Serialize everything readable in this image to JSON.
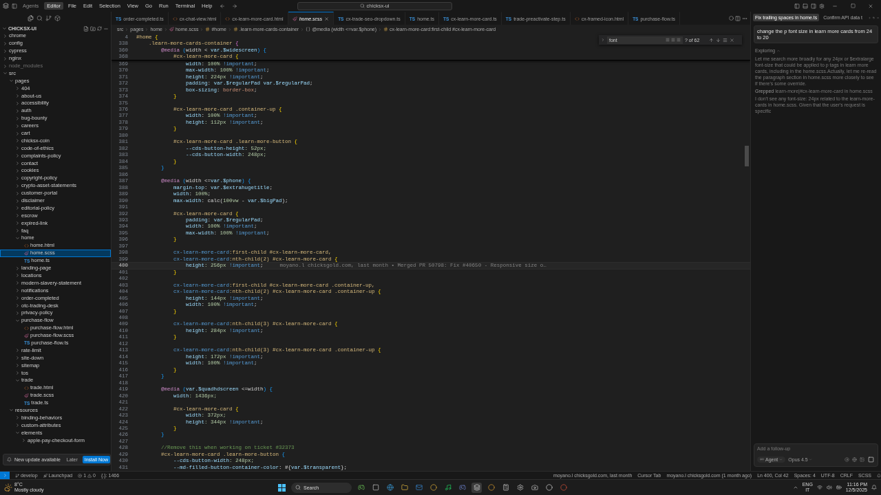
{
  "title_bar": {
    "modes": [
      {
        "label": "Agents",
        "selected": false
      },
      {
        "label": "Editor",
        "selected": true
      }
    ],
    "menu": [
      "File",
      "Edit",
      "Selection",
      "View",
      "Go",
      "Run",
      "Terminal",
      "Help"
    ],
    "search": {
      "value": "chicksx-ui"
    }
  },
  "explorer": {
    "title": "CHICKSX-UI",
    "expanded": true,
    "tree": [
      {
        "label": "chrome",
        "kind": "folder",
        "expanded": false,
        "selected": false,
        "ignored": false
      },
      {
        "label": "config",
        "kind": "folder",
        "expanded": false,
        "selected": false,
        "ignored": false
      },
      {
        "label": "cypress",
        "kind": "folder",
        "expanded": false,
        "selected": false,
        "ignored": false
      },
      {
        "label": "nginx",
        "kind": "folder",
        "expanded": false,
        "selected": false,
        "ignored": false
      },
      {
        "label": "node_modules",
        "kind": "folder",
        "expanded": false,
        "selected": false,
        "ignored": true
      },
      {
        "label": "src",
        "kind": "folder",
        "expanded": true,
        "selected": false,
        "ignored": false,
        "children": [
          {
            "label": "pages",
            "kind": "folder",
            "expanded": true,
            "selected": false,
            "children": [
              {
                "label": "404",
                "kind": "folder",
                "expanded": false,
                "selected": false
              },
              {
                "label": "about-us",
                "kind": "folder",
                "expanded": false,
                "selected": false
              },
              {
                "label": "accessibility",
                "kind": "folder",
                "expanded": false,
                "selected": false
              },
              {
                "label": "auth",
                "kind": "folder",
                "expanded": false,
                "selected": false
              },
              {
                "label": "bug-bounty",
                "kind": "folder",
                "expanded": false,
                "selected": false
              },
              {
                "label": "careers",
                "kind": "folder",
                "expanded": false,
                "selected": false
              },
              {
                "label": "cart",
                "kind": "folder",
                "expanded": false,
                "selected": false
              },
              {
                "label": "chicksx-coin",
                "kind": "folder",
                "expanded": false,
                "selected": false
              },
              {
                "label": "code-of-ethics",
                "kind": "folder",
                "expanded": false,
                "selected": false
              },
              {
                "label": "complaints-policy",
                "kind": "folder",
                "expanded": false,
                "selected": false
              },
              {
                "label": "contact",
                "kind": "folder",
                "expanded": false,
                "selected": false
              },
              {
                "label": "cookies",
                "kind": "folder",
                "expanded": false,
                "selected": false
              },
              {
                "label": "copyright-policy",
                "kind": "folder",
                "expanded": false,
                "selected": false
              },
              {
                "label": "crypto-asset-statements",
                "kind": "folder",
                "expanded": false,
                "selected": false
              },
              {
                "label": "customer-portal",
                "kind": "folder",
                "expanded": false,
                "selected": false
              },
              {
                "label": "disclaimer",
                "kind": "folder",
                "expanded": false,
                "selected": false
              },
              {
                "label": "editorial-policy",
                "kind": "folder",
                "expanded": false,
                "selected": false
              },
              {
                "label": "escrow",
                "kind": "folder",
                "expanded": false,
                "selected": false
              },
              {
                "label": "expired-link",
                "kind": "folder",
                "expanded": false,
                "selected": false
              },
              {
                "label": "faq",
                "kind": "folder",
                "expanded": false,
                "selected": false
              },
              {
                "label": "home",
                "kind": "folder",
                "expanded": true,
                "selected": false,
                "children": [
                  {
                    "label": "home.html",
                    "kind": "html",
                    "selected": false
                  },
                  {
                    "label": "home.scss",
                    "kind": "scss",
                    "selected": true
                  },
                  {
                    "label": "home.ts",
                    "kind": "ts",
                    "badge": "TS",
                    "selected": false
                  }
                ]
              },
              {
                "label": "landing-page",
                "kind": "folder",
                "expanded": false,
                "selected": false
              },
              {
                "label": "locations",
                "kind": "folder",
                "expanded": false,
                "selected": false
              },
              {
                "label": "modern-slavery-statement",
                "kind": "folder",
                "expanded": false,
                "selected": false
              },
              {
                "label": "notifications",
                "kind": "folder",
                "expanded": false,
                "selected": false
              },
              {
                "label": "order-completed",
                "kind": "folder",
                "expanded": false,
                "selected": false
              },
              {
                "label": "otc-trading-desk",
                "kind": "folder",
                "expanded": false,
                "selected": false
              },
              {
                "label": "privacy-policy",
                "kind": "folder",
                "expanded": false,
                "selected": false
              },
              {
                "label": "purchase-flow",
                "kind": "folder",
                "expanded": true,
                "selected": false,
                "children": [
                  {
                    "label": "purchase-flow.html",
                    "kind": "html",
                    "selected": false
                  },
                  {
                    "label": "purchase-flow.scss",
                    "kind": "scss",
                    "selected": false
                  },
                  {
                    "label": "purchase-flow.ts",
                    "kind": "ts",
                    "badge": "TS",
                    "selected": false
                  }
                ]
              },
              {
                "label": "rate-limit",
                "kind": "folder",
                "expanded": false,
                "selected": false
              },
              {
                "label": "site-down",
                "kind": "folder",
                "expanded": false,
                "selected": false
              },
              {
                "label": "sitemap",
                "kind": "folder",
                "expanded": false,
                "selected": false
              },
              {
                "label": "tos",
                "kind": "folder",
                "expanded": false,
                "selected": false
              },
              {
                "label": "trade",
                "kind": "folder",
                "expanded": true,
                "selected": false,
                "children": [
                  {
                    "label": "trade.html",
                    "kind": "html",
                    "selected": false
                  },
                  {
                    "label": "trade.scss",
                    "kind": "scss",
                    "selected": false
                  },
                  {
                    "label": "trade.ts",
                    "kind": "ts",
                    "badge": "TS",
                    "selected": false
                  }
                ]
              }
            ]
          },
          {
            "label": "resources",
            "kind": "folder",
            "expanded": true,
            "selected": false,
            "children": [
              {
                "label": "binding-behaviors",
                "kind": "folder",
                "expanded": false,
                "selected": false
              },
              {
                "label": "custom-attributes",
                "kind": "folder",
                "expanded": false,
                "selected": false
              },
              {
                "label": "elements",
                "kind": "folder",
                "expanded": true,
                "selected": false,
                "children": [
                  {
                    "label": "apple-pay-checkout-form",
                    "kind": "folder",
                    "expanded": false,
                    "selected": false
                  }
                ]
              }
            ]
          }
        ]
      }
    ]
  },
  "notification": {
    "message": "New update available",
    "actions": [
      {
        "label": "Later",
        "primary": false
      },
      {
        "label": "Install Now",
        "primary": true
      }
    ]
  },
  "tabs": [
    {
      "label": "order-completed.ts",
      "kind": "ts",
      "badge": "TS",
      "selected": false
    },
    {
      "label": "cx-chat-view.html",
      "kind": "html",
      "selected": false
    },
    {
      "label": "cx-learn-more-card.html",
      "kind": "html",
      "selected": false
    },
    {
      "label": "home.scss",
      "kind": "scss",
      "selected": true
    },
    {
      "label": "cx-trade-seo-dropdown.ts",
      "kind": "ts",
      "badge": "TS",
      "selected": false
    },
    {
      "label": "home.ts",
      "kind": "ts",
      "badge": "TS",
      "selected": false
    },
    {
      "label": "cx-learn-more-card.ts",
      "kind": "ts",
      "badge": "TS",
      "selected": false
    },
    {
      "label": "trade-preactivate-step.ts",
      "kind": "ts",
      "badge": "TS",
      "selected": false
    },
    {
      "label": "cx-framed-icon.html",
      "kind": "html",
      "selected": false
    },
    {
      "label": "purchase-flow.ts",
      "kind": "ts",
      "badge": "TS",
      "selected": false
    }
  ],
  "breadcrumb": [
    {
      "kind": "text",
      "text": "src"
    },
    {
      "kind": "text",
      "text": "pages"
    },
    {
      "kind": "text",
      "text": "home"
    },
    {
      "kind": "scss",
      "text": "home.scss"
    },
    {
      "kind": "selector",
      "text": "#home"
    },
    {
      "kind": "selector",
      "text": ".learn-more-cards-container"
    },
    {
      "kind": "block",
      "text": "@media (width <=var.$phone)"
    },
    {
      "kind": "selector",
      "text": "cx-learn-more-card:first-child #cx-learn-more-card"
    }
  ],
  "find": {
    "value": "font",
    "count": "? of 62"
  },
  "code": {
    "sticky": [
      {
        "number": "4",
        "tokens": [
          {
            "kind": "selector",
            "text": "#home"
          },
          {
            "kind": "brace1",
            "text": " {"
          }
        ]
      },
      {
        "number": "338",
        "tokens": [
          {
            "kind": "selector",
            "text": "    .learn-more-cards-container"
          },
          {
            "kind": "brace2",
            "text": " {"
          }
        ]
      },
      {
        "number": "360",
        "tokens": [
          {
            "kind": "at_rule",
            "text": "        @media"
          },
          {
            "kind": "brace3",
            "text": " ("
          },
          {
            "kind": "plain",
            "text": "width < "
          },
          {
            "kind": "variable",
            "text": "var.$widescreen"
          },
          {
            "kind": "brace3",
            "text": ") {"
          }
        ]
      },
      {
        "number": "368",
        "tokens": [
          {
            "kind": "selector",
            "text": "            #cx-learn-more-card"
          },
          {
            "kind": "brace1",
            "text": " {"
          }
        ]
      }
    ],
    "lines": [
      {
        "number": "369",
        "current": false,
        "tokens": [
          {
            "kind": "property",
            "text": "                width"
          },
          {
            "kind": "plain",
            "text": ": "
          },
          {
            "kind": "number",
            "text": "100%"
          },
          {
            "kind": "keyword",
            "text": " !important"
          },
          {
            "kind": "plain",
            "text": ";"
          }
        ]
      },
      {
        "number": "370",
        "current": false,
        "tokens": [
          {
            "kind": "property",
            "text": "                max-width"
          },
          {
            "kind": "plain",
            "text": ": "
          },
          {
            "kind": "number",
            "text": "100%"
          },
          {
            "kind": "keyword",
            "text": " !important"
          },
          {
            "kind": "plain",
            "text": ";"
          }
        ]
      },
      {
        "number": "371",
        "current": false,
        "tokens": [
          {
            "kind": "property",
            "text": "                height"
          },
          {
            "kind": "number",
            "text": ": 224px"
          },
          {
            "kind": "keyword",
            "text": " !important"
          },
          {
            "kind": "plain",
            "text": ";"
          }
        ]
      },
      {
        "number": "372",
        "current": false,
        "tokens": [
          {
            "kind": "property",
            "text": "                padding"
          },
          {
            "kind": "plain",
            "text": ": "
          },
          {
            "kind": "variable",
            "text": "var.$regularPad var.$regularPad"
          },
          {
            "kind": "plain",
            "text": ";"
          }
        ]
      },
      {
        "number": "373",
        "current": false,
        "tokens": [
          {
            "kind": "property",
            "text": "                box-sizing"
          },
          {
            "kind": "plain",
            "text": ": "
          },
          {
            "kind": "string",
            "text": "border-box"
          },
          {
            "kind": "plain",
            "text": ";"
          }
        ]
      },
      {
        "number": "374",
        "current": false,
        "tokens": [
          {
            "kind": "brace1",
            "text": "            }"
          }
        ]
      },
      {
        "number": "375",
        "current": false
      },
      {
        "number": "376",
        "current": false,
        "tokens": [
          {
            "kind": "selector",
            "text": "            #cx-learn-more-card .container-up"
          },
          {
            "kind": "brace1",
            "text": " {"
          }
        ]
      },
      {
        "number": "377",
        "current": false,
        "tokens": [
          {
            "kind": "property",
            "text": "                width"
          },
          {
            "kind": "plain",
            "text": ": "
          },
          {
            "kind": "number",
            "text": "100%"
          },
          {
            "kind": "keyword",
            "text": " !important"
          },
          {
            "kind": "plain",
            "text": ";"
          }
        ]
      },
      {
        "number": "378",
        "current": false,
        "tokens": [
          {
            "kind": "property",
            "text": "                height"
          },
          {
            "kind": "number",
            "text": ": 112px"
          },
          {
            "kind": "keyword",
            "text": " !important"
          },
          {
            "kind": "plain",
            "text": ";"
          }
        ]
      },
      {
        "number": "379",
        "current": false,
        "tokens": [
          {
            "kind": "brace1",
            "text": "            }"
          }
        ]
      },
      {
        "number": "380",
        "current": false
      },
      {
        "number": "381",
        "current": false,
        "tokens": [
          {
            "kind": "selector",
            "text": "            #cx-learn-more-card .learn-more-button"
          },
          {
            "kind": "brace1",
            "text": " {"
          }
        ]
      },
      {
        "number": "382",
        "current": false,
        "tokens": [
          {
            "kind": "property",
            "text": "                --cds-button-height"
          },
          {
            "kind": "number",
            "text": ": 52px;"
          }
        ]
      },
      {
        "number": "383",
        "current": false,
        "tokens": [
          {
            "kind": "property",
            "text": "                --cds-button-width"
          },
          {
            "kind": "number",
            "text": ": 248px;"
          }
        ]
      },
      {
        "number": "384",
        "current": false,
        "tokens": [
          {
            "kind": "brace1",
            "text": "            }"
          }
        ]
      },
      {
        "number": "385",
        "current": false,
        "tokens": [
          {
            "kind": "brace3",
            "text": "        }"
          }
        ]
      },
      {
        "number": "386",
        "current": false
      },
      {
        "number": "387",
        "current": false,
        "tokens": [
          {
            "kind": "at_rule",
            "text": "        @media"
          },
          {
            "kind": "brace3",
            "text": " ("
          },
          {
            "kind": "plain",
            "text": "width <="
          },
          {
            "kind": "variable",
            "text": "var.$phone"
          },
          {
            "kind": "brace3",
            "text": ") {"
          }
        ]
      },
      {
        "number": "388",
        "current": false,
        "tokens": [
          {
            "kind": "property",
            "text": "            margin-top"
          },
          {
            "kind": "plain",
            "text": ": "
          },
          {
            "kind": "variable",
            "text": "var.$extrahugetitle"
          },
          {
            "kind": "plain",
            "text": ";"
          }
        ]
      },
      {
        "number": "389",
        "current": false,
        "tokens": [
          {
            "kind": "property",
            "text": "            width"
          },
          {
            "kind": "plain",
            "text": ": "
          },
          {
            "kind": "number",
            "text": "100%"
          },
          {
            "kind": "plain",
            "text": ";"
          }
        ]
      },
      {
        "number": "390",
        "current": false,
        "tokens": [
          {
            "kind": "property",
            "text": "            max-width"
          },
          {
            "kind": "plain",
            "text": ": calc("
          },
          {
            "kind": "number",
            "text": "100vw"
          },
          {
            "kind": "plain",
            "text": " - "
          },
          {
            "kind": "variable",
            "text": "var.$bigPad"
          },
          {
            "kind": "plain",
            "text": ");"
          }
        ]
      },
      {
        "number": "391",
        "current": false
      },
      {
        "number": "392",
        "current": false,
        "tokens": [
          {
            "kind": "selector",
            "text": "            #cx-learn-more-card"
          },
          {
            "kind": "brace1",
            "text": " {"
          }
        ]
      },
      {
        "number": "393",
        "current": false,
        "tokens": [
          {
            "kind": "property",
            "text": "                padding"
          },
          {
            "kind": "plain",
            "text": ": "
          },
          {
            "kind": "variable",
            "text": "var.$regularPad"
          },
          {
            "kind": "plain",
            "text": ";"
          }
        ]
      },
      {
        "number": "394",
        "current": false,
        "tokens": [
          {
            "kind": "property",
            "text": "                width"
          },
          {
            "kind": "plain",
            "text": ": "
          },
          {
            "kind": "number",
            "text": "100%"
          },
          {
            "kind": "keyword",
            "text": " !important"
          },
          {
            "kind": "plain",
            "text": ";"
          }
        ]
      },
      {
        "number": "395",
        "current": false,
        "tokens": [
          {
            "kind": "property",
            "text": "                max-width"
          },
          {
            "kind": "plain",
            "text": ": "
          },
          {
            "kind": "number",
            "text": "100%"
          },
          {
            "kind": "keyword",
            "text": " !important"
          },
          {
            "kind": "plain",
            "text": ";"
          }
        ]
      },
      {
        "number": "396",
        "current": false,
        "tokens": [
          {
            "kind": "brace1",
            "text": "            }"
          }
        ]
      },
      {
        "number": "397",
        "current": false
      },
      {
        "number": "398",
        "current": false,
        "tokens": [
          {
            "kind": "tag",
            "text": "            cx-learn-more-card"
          },
          {
            "kind": "selector",
            "text": ":first-child #cx-learn-more-card,"
          }
        ]
      },
      {
        "number": "399",
        "current": false,
        "tokens": [
          {
            "kind": "tag",
            "text": "            cx-learn-more-card"
          },
          {
            "kind": "selector",
            "text": ":nth-child(2) #cx-learn-more-card"
          },
          {
            "kind": "brace1",
            "text": " {"
          }
        ]
      },
      {
        "number": "400",
        "current": true,
        "blame": "moyano.l chicksgold.com, last month • Merged PR 50798: Fix #40650 - Responsive size o…",
        "tokens": [
          {
            "kind": "property",
            "text": "                height"
          },
          {
            "kind": "number",
            "text": ": 256px"
          },
          {
            "kind": "keyword",
            "text": " !important"
          },
          {
            "kind": "plain",
            "text": ";"
          }
        ]
      },
      {
        "number": "401",
        "current": false,
        "tokens": [
          {
            "kind": "brace1",
            "text": "            }"
          }
        ]
      },
      {
        "number": "402",
        "current": false
      },
      {
        "number": "403",
        "current": false,
        "tokens": [
          {
            "kind": "tag",
            "text": "            cx-learn-more-card"
          },
          {
            "kind": "selector",
            "text": ":first-child #cx-learn-more-card .container-up,"
          }
        ]
      },
      {
        "number": "404",
        "current": false,
        "tokens": [
          {
            "kind": "tag",
            "text": "            cx-learn-more-card"
          },
          {
            "kind": "selector",
            "text": ":nth-child(2) #cx-learn-more-card .container-up"
          },
          {
            "kind": "brace1",
            "text": " {"
          }
        ]
      },
      {
        "number": "405",
        "current": false,
        "tokens": [
          {
            "kind": "property",
            "text": "                height"
          },
          {
            "kind": "number",
            "text": ": 144px"
          },
          {
            "kind": "keyword",
            "text": " !important"
          },
          {
            "kind": "plain",
            "text": ";"
          }
        ]
      },
      {
        "number": "406",
        "current": false,
        "tokens": [
          {
            "kind": "property",
            "text": "                width"
          },
          {
            "kind": "plain",
            "text": ": "
          },
          {
            "kind": "number",
            "text": "100%"
          },
          {
            "kind": "keyword",
            "text": " !important"
          },
          {
            "kind": "plain",
            "text": ";"
          }
        ]
      },
      {
        "number": "407",
        "current": false,
        "tokens": [
          {
            "kind": "brace1",
            "text": "            }"
          }
        ]
      },
      {
        "number": "408",
        "current": false
      },
      {
        "number": "409",
        "current": false,
        "tokens": [
          {
            "kind": "tag",
            "text": "            cx-learn-more-card"
          },
          {
            "kind": "selector",
            "text": ":nth-child(3) #cx-learn-more-card"
          },
          {
            "kind": "brace1",
            "text": " {"
          }
        ]
      },
      {
        "number": "410",
        "current": false,
        "tokens": [
          {
            "kind": "property",
            "text": "                height"
          },
          {
            "kind": "number",
            "text": ": 284px"
          },
          {
            "kind": "keyword",
            "text": " !important"
          },
          {
            "kind": "plain",
            "text": ";"
          }
        ]
      },
      {
        "number": "411",
        "current": false,
        "tokens": [
          {
            "kind": "brace1",
            "text": "            }"
          }
        ]
      },
      {
        "number": "412",
        "current": false
      },
      {
        "number": "413",
        "current": false,
        "tokens": [
          {
            "kind": "tag",
            "text": "            cx-learn-more-card"
          },
          {
            "kind": "selector",
            "text": ":nth-child(3) #cx-learn-more-card .container-up"
          },
          {
            "kind": "brace1",
            "text": " {"
          }
        ]
      },
      {
        "number": "414",
        "current": false,
        "tokens": [
          {
            "kind": "property",
            "text": "                height"
          },
          {
            "kind": "number",
            "text": ": 172px"
          },
          {
            "kind": "keyword",
            "text": " !important"
          },
          {
            "kind": "plain",
            "text": ";"
          }
        ]
      },
      {
        "number": "415",
        "current": false,
        "tokens": [
          {
            "kind": "property",
            "text": "                width"
          },
          {
            "kind": "plain",
            "text": ": "
          },
          {
            "kind": "number",
            "text": "100%"
          },
          {
            "kind": "keyword",
            "text": " !important"
          },
          {
            "kind": "plain",
            "text": ";"
          }
        ]
      },
      {
        "number": "416",
        "current": false,
        "tokens": [
          {
            "kind": "brace1",
            "text": "            }"
          }
        ]
      },
      {
        "number": "417",
        "current": false,
        "tokens": [
          {
            "kind": "brace3",
            "text": "        }"
          }
        ]
      },
      {
        "number": "418",
        "current": false
      },
      {
        "number": "419",
        "current": false,
        "tokens": [
          {
            "kind": "at_rule",
            "text": "        @media"
          },
          {
            "kind": "brace3",
            "text": " ("
          },
          {
            "kind": "variable",
            "text": "var.$quadhdscreen"
          },
          {
            "kind": "plain",
            "text": " <=width"
          },
          {
            "kind": "brace3",
            "text": ") {"
          }
        ]
      },
      {
        "number": "420",
        "current": false,
        "tokens": [
          {
            "kind": "property",
            "text": "            width"
          },
          {
            "kind": "number",
            "text": ": 1436px;"
          }
        ]
      },
      {
        "number": "421",
        "current": false
      },
      {
        "number": "422",
        "current": false,
        "tokens": [
          {
            "kind": "selector",
            "text": "            #cx-learn-more-card"
          },
          {
            "kind": "brace1",
            "text": " {"
          }
        ]
      },
      {
        "number": "423",
        "current": false,
        "tokens": [
          {
            "kind": "property",
            "text": "                width"
          },
          {
            "kind": "number",
            "text": ": 372px;"
          }
        ]
      },
      {
        "number": "424",
        "current": false,
        "tokens": [
          {
            "kind": "property",
            "text": "                height"
          },
          {
            "kind": "number",
            "text": ": 344px"
          },
          {
            "kind": "keyword",
            "text": " !important"
          },
          {
            "kind": "plain",
            "text": ";"
          }
        ]
      },
      {
        "number": "425",
        "current": false,
        "tokens": [
          {
            "kind": "brace1",
            "text": "            }"
          }
        ]
      },
      {
        "number": "426",
        "current": false,
        "tokens": [
          {
            "kind": "brace3",
            "text": "        }"
          }
        ]
      },
      {
        "number": "427",
        "current": false
      },
      {
        "number": "428",
        "current": false,
        "tokens": [
          {
            "kind": "comment",
            "text": "        //Remove this when working on ticket #32373"
          }
        ]
      },
      {
        "number": "429",
        "current": false,
        "tokens": [
          {
            "kind": "selector",
            "text": "        #cx-learn-more-card .learn-more-button"
          },
          {
            "kind": "brace3",
            "text": " {"
          }
        ]
      },
      {
        "number": "430",
        "current": false,
        "tokens": [
          {
            "kind": "property",
            "text": "            --cds-button-width"
          },
          {
            "kind": "number",
            "text": ": 248px;"
          }
        ]
      },
      {
        "number": "431",
        "current": false,
        "tokens": [
          {
            "kind": "property",
            "text": "            --md-filled-button-container-color"
          },
          {
            "kind": "plain",
            "text": ": #{"
          },
          {
            "kind": "variable",
            "text": "var.$transparent"
          },
          {
            "kind": "plain",
            "text": "};"
          }
        ]
      }
    ]
  },
  "chat": {
    "tabs": [
      {
        "label": "Fix trailing spaces in home.ts",
        "selected": true
      },
      {
        "label": "Confirm API data t",
        "selected": false
      }
    ],
    "message": "change the p font size in learn more cards from 24 to 20",
    "section": {
      "label": "Exploring",
      "expanded": true
    },
    "steps": [
      {
        "kind": "thought",
        "text": "Let me search more broadly for any 24px or $extralarge font-size that could be applied to p tags in learn more cards, including in the home.scss.Actually, let me re-read the paragraph section in home.scss more closely to see if there's some override."
      },
      {
        "kind": "tool",
        "label": "Grepped",
        "text": "learn-more|#cx-learn-more-card in home.scss"
      },
      {
        "kind": "thought",
        "text": "I don't see any font-size: 24px related to the learn-more-cards in home.scss. Given that the user's request is specific"
      }
    ],
    "input": {
      "placeholder": "Add a follow-up",
      "mode": "Agent",
      "model": "Opus 4.5"
    }
  },
  "status_bar": {
    "branch": "develop",
    "launchpad": "Launchpad",
    "errors": "1",
    "warnings": "0",
    "extra": "{.}: 1466",
    "right": [
      "moyano.l chicksgold.com, last month",
      "Cursor Tab",
      "moyano.l chicksgold.com (1 month ago)",
      "Ln 400, Col 42",
      "Spaces: 4",
      "UTF-8",
      "CRLF",
      "SCSS"
    ]
  },
  "taskbar": {
    "weather": {
      "temp": "8°C",
      "condition": "Mostly cloudy"
    },
    "search": "Search",
    "language": "ENG",
    "layout": "IT",
    "time": "11:16 PM",
    "date": "12/5/2025"
  }
}
